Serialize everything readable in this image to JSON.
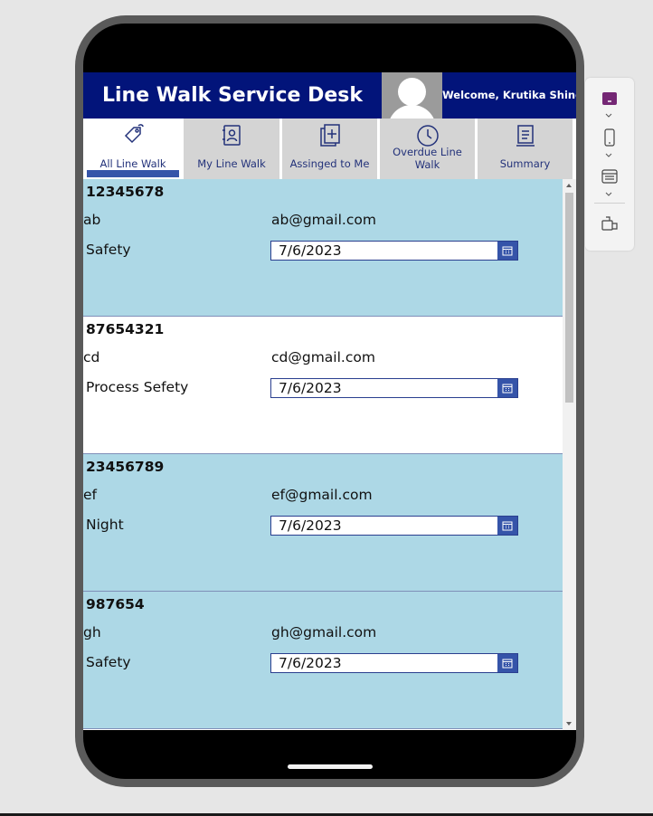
{
  "app": {
    "title": "Line Walk Service Desk",
    "welcome": "Welcome, Krutika Shinde"
  },
  "tabs": [
    {
      "label": "All Line Walk",
      "icon": "tag-icon",
      "active": true
    },
    {
      "label": "My Line Walk",
      "icon": "contact-book-icon",
      "active": false
    },
    {
      "label": "Assinged to Me",
      "icon": "add-document-icon",
      "active": false
    },
    {
      "label": "Overdue Line Walk",
      "icon": "clock-icon",
      "active": false
    },
    {
      "label": "Summary",
      "icon": "document-list-icon",
      "active": false
    }
  ],
  "records": [
    {
      "id": "12345678",
      "name": "ab",
      "email": "ab@gmail.com",
      "category": "Safety",
      "date": "7/6/2023"
    },
    {
      "id": "87654321",
      "name": "cd",
      "email": "cd@gmail.com",
      "category": "Process Sefety",
      "date": "7/6/2023"
    },
    {
      "id": "23456789",
      "name": "ef",
      "email": "ef@gmail.com",
      "category": "Night",
      "date": "7/6/2023"
    },
    {
      "id": "987654",
      "name": "gh",
      "email": "gh@gmail.com",
      "category": "Safety",
      "date": "7/6/2023"
    }
  ],
  "colors": {
    "header": "#02147a",
    "row_alt": "#add8e6",
    "tab_inactive": "#d4d4d4",
    "accent": "#3554a9",
    "side_accent": "#742774"
  },
  "side_toolbar": {
    "icons": [
      "app-layout-icon",
      "phone-icon",
      "screen-icon",
      "run-icon"
    ]
  }
}
